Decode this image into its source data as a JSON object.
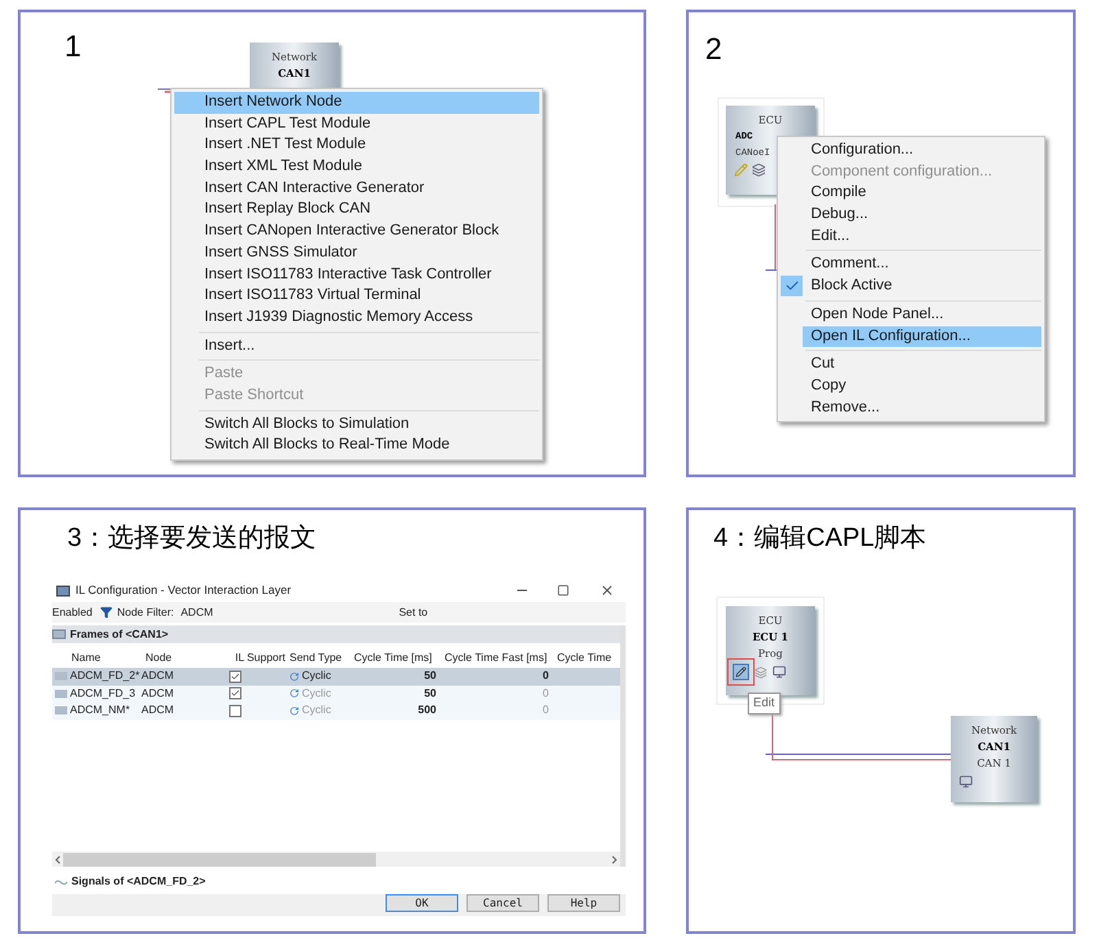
{
  "panel_1": {
    "heading": "1",
    "block": {
      "title": "Network",
      "name": "CAN1"
    },
    "menu": {
      "groups": [
        [
          {
            "label": "Insert Network Node",
            "selected": true,
            "disabled": false
          },
          {
            "label": "Insert CAPL Test Module",
            "selected": false,
            "disabled": false
          },
          {
            "label": "Insert .NET Test Module",
            "selected": false,
            "disabled": false
          },
          {
            "label": "Insert XML Test Module",
            "selected": false,
            "disabled": false
          },
          {
            "label": "Insert CAN Interactive Generator",
            "selected": false,
            "disabled": false
          },
          {
            "label": "Insert Replay Block CAN",
            "selected": false,
            "disabled": false
          },
          {
            "label": "Insert CANopen Interactive Generator Block",
            "selected": false,
            "disabled": false
          },
          {
            "label": "Insert GNSS Simulator",
            "selected": false,
            "disabled": false
          },
          {
            "label": "Insert ISO11783 Interactive Task Controller",
            "selected": false,
            "disabled": false
          },
          {
            "label": "Insert ISO11783 Virtual Terminal",
            "selected": false,
            "disabled": false
          },
          {
            "label": "Insert J1939 Diagnostic Memory Access",
            "selected": false,
            "disabled": false
          }
        ],
        [
          {
            "label": "Insert...",
            "selected": false,
            "disabled": false
          }
        ],
        [
          {
            "label": "Paste",
            "selected": false,
            "disabled": true
          },
          {
            "label": "Paste Shortcut",
            "selected": false,
            "disabled": true
          }
        ],
        [
          {
            "label": "Switch All Blocks to Simulation",
            "selected": false,
            "disabled": false
          },
          {
            "label": "Switch All Blocks to Real-Time Mode",
            "selected": false,
            "disabled": false
          }
        ]
      ]
    }
  },
  "panel_2": {
    "heading": "2",
    "block": {
      "title": "ECU",
      "name": "ADC",
      "line_3": "CANoeI"
    },
    "menu": {
      "groups": [
        [
          {
            "label": "Configuration...",
            "selected": false,
            "disabled": false,
            "checked": false
          },
          {
            "label": "Component configuration...",
            "selected": false,
            "disabled": true,
            "checked": false
          },
          {
            "label": "Compile",
            "selected": false,
            "disabled": false,
            "checked": false
          },
          {
            "label": "Debug...",
            "selected": false,
            "disabled": false,
            "checked": false
          },
          {
            "label": "Edit...",
            "selected": false,
            "disabled": false,
            "checked": false
          }
        ],
        [
          {
            "label": "Comment...",
            "selected": false,
            "disabled": false,
            "checked": false
          },
          {
            "label": "Block Active",
            "selected": false,
            "disabled": false,
            "checked": true
          }
        ],
        [
          {
            "label": "Open Node Panel...",
            "selected": false,
            "disabled": false,
            "checked": false
          },
          {
            "label": "Open IL Configuration...",
            "selected": true,
            "disabled": false,
            "checked": false
          }
        ],
        [
          {
            "label": "Cut",
            "selected": false,
            "disabled": false,
            "checked": false
          },
          {
            "label": "Copy",
            "selected": false,
            "disabled": false,
            "checked": false
          },
          {
            "label": "Remove...",
            "selected": false,
            "disabled": false,
            "checked": false
          }
        ]
      ]
    }
  },
  "panel_3": {
    "heading": "3：选择要发送的报文",
    "window": {
      "title": "IL Configuration - Vector Interaction Layer",
      "toolbar": {
        "enabled": "Enabled",
        "filter_label": "Node Filter:",
        "filter_value": "ADCM",
        "set_to": "Set to"
      },
      "frames_title": "Frames of <CAN1>",
      "columns": [
        "Name",
        "Node",
        "IL Support",
        "Send Type",
        "Cycle Time [ms]",
        "Cycle Time Fast [ms]",
        "Cycle Time"
      ],
      "rows": [
        {
          "name": "ADCM_FD_2*",
          "node": "ADCM",
          "il_support": true,
          "send_type": "Cyclic",
          "cycle_time": "50",
          "cycle_time_fast": "0",
          "selected": true
        },
        {
          "name": "ADCM_FD_3",
          "node": "ADCM",
          "il_support": true,
          "send_type": "Cyclic",
          "cycle_time": "50",
          "cycle_time_fast": "0",
          "selected": false
        },
        {
          "name": "ADCM_NM*",
          "node": "ADCM",
          "il_support": false,
          "send_type": "Cyclic",
          "cycle_time": "500",
          "cycle_time_fast": "0",
          "selected": false
        }
      ],
      "signals_title": "Signals of <ADCM_FD_2>",
      "buttons": [
        "OK",
        "Cancel",
        "Help"
      ]
    }
  },
  "panel_4": {
    "heading": "4：编辑CAPL脚本",
    "ecu_block": {
      "title": "ECU",
      "name": "ECU 1",
      "line_3": "Prog"
    },
    "tooltip": "Edit",
    "network_block": {
      "title": "Network",
      "name": "CAN1",
      "line_3": "CAN 1"
    }
  }
}
